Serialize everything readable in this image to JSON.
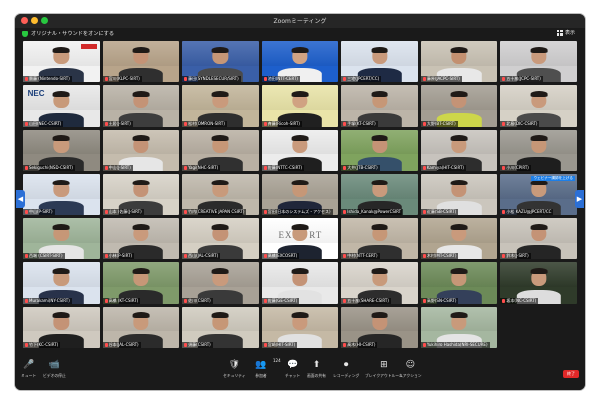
{
  "window": {
    "title": "Zoomミーティング"
  },
  "topbar": {
    "original_sound": "オリジナル・サウンドをオンにする",
    "view_label": "表示"
  },
  "tiles": [
    {
      "name": "齋藤 (Nintendo-SIRT)",
      "bg": "#f2f2f2",
      "shirt": "#2a3447",
      "skin": "#c89a7b",
      "special": "redtag"
    },
    {
      "name": "宮川(KLPC-SIRT)",
      "bg": "#b8a48a",
      "shirt": "#2f2f2f",
      "skin": "#c49376"
    },
    {
      "name": "藤田(SYNDLESECUR/SIRT)",
      "bg": "#3a5fa8",
      "shirt": "#4a4a4a",
      "skin": "#c69777"
    },
    {
      "name": "池田(NTT-CERT)",
      "bg": "#1d5fcc",
      "shirt": "#f0f0f0",
      "skin": "#d1a383"
    },
    {
      "name": "三宅(JPCERT/CC)",
      "bg": "#dbe3ee",
      "shirt": "#1e2a44",
      "skin": "#c99a7c"
    },
    {
      "name": "藤原(JACPC-SIRT)",
      "bg": "#c9c2b4",
      "shirt": "#e8e8e8",
      "skin": "#c39070"
    },
    {
      "name": "五十嵐(JCPC-SIRT)",
      "bg": "#d0cfd0",
      "shirt": "#4f4f4f",
      "skin": "#c99a7c"
    },
    {
      "name": "山田(NEC-CSIRT)",
      "bg": "#e8e8e8",
      "shirt": "#1f2a3d",
      "skin": "#c89a7a",
      "sign": "NEC"
    },
    {
      "name": "土居(J-SIRT)",
      "bg": "#b9b2a6",
      "shirt": "#3d3d3d",
      "skin": "#c49376"
    },
    {
      "name": "松村(OMRON-SIRT)",
      "bg": "#c2b59a",
      "shirt": "#2e2e2e",
      "skin": "#c99a7c"
    },
    {
      "name": "斉藤(Ricoh-SIRT)",
      "bg": "#e9e4a8",
      "shirt": "#202020",
      "skin": "#d0a282"
    },
    {
      "name": "手塚(KT-CSIRT)",
      "bg": "#bcb4a8",
      "shirt": "#3a3a3a",
      "skin": "#c69777"
    },
    {
      "name": "大野(BT-CSIRT)",
      "bg": "#a39d92",
      "shirt": "#cdd64a",
      "skin": "#c49376"
    },
    {
      "name": "北島(DIC-CSIRT)",
      "bg": "#d6d1c6",
      "shirt": "#4a4a4a",
      "skin": "#c99a7c"
    },
    {
      "name": "Sekiguchi(NSD-CSIRT)",
      "bg": "#8f8a80",
      "shirt": "#2a2a2a",
      "skin": "#c89a7b"
    },
    {
      "name": "中山(J-SIRT)",
      "bg": "#c5bcad",
      "shirt": "#e6e6e6",
      "skin": "#c49376"
    },
    {
      "name": "Yagi(NHC-SIRT)",
      "bg": "#b9b0a3",
      "shirt": "#303030",
      "skin": "#c69777"
    },
    {
      "name": "佐藤(NTTC-CSIRT)",
      "bg": "#ececec",
      "shirt": "#1f1f1f",
      "skin": "#c99a7c"
    },
    {
      "name": "大井(JTB-CSIRT)",
      "bg": "#7fa35e",
      "shirt": "#35506a",
      "skin": "#c49376"
    },
    {
      "name": "Kamiya(HIT-CSIRT)",
      "bg": "#c7c3bd",
      "shirt": "#2d2d2d",
      "skin": "#c89a7b"
    },
    {
      "name": "小川(CPIRT)",
      "bg": "#9a978f",
      "shirt": "#1e1e1e",
      "skin": "#c69777"
    },
    {
      "name": "中山(P-SIRT)",
      "bg": "#dbe3ee",
      "shirt": "#2c3a55",
      "skin": "#c99a7c"
    },
    {
      "name": "山本 (佐藤(J-SIRT)",
      "bg": "#d7d2c7",
      "shirt": "#3c3c3c",
      "skin": "#c49376"
    },
    {
      "name": "竹内(CREATIVE JAPAN CSIRT)",
      "bg": "#bfb8ab",
      "shirt": "#2b2b2b",
      "skin": "#c89a7b"
    },
    {
      "name": "宮田(日本のシステムズ・アクセス)",
      "bg": "#a9a295",
      "shirt": "#20263a",
      "skin": "#c69777"
    },
    {
      "name": "Ishida_Kanak@PowerCSIRT",
      "bg": "#6a8a7a",
      "shirt": "#272727",
      "skin": "#c99a7c"
    },
    {
      "name": "近藤(SB-CSIRT)",
      "bg": "#cbc6bd",
      "shirt": "#e0e0e0",
      "skin": "#c49376"
    },
    {
      "name": "小松 KAZU@JPCERT/CC",
      "bg": "#5a6d8a",
      "shirt": "#333333",
      "skin": "#c89a7b",
      "highlight": "ウェビナー講師を上げる"
    },
    {
      "name": "西端 (CSIRT-SIRT)",
      "bg": "#9fb59a",
      "shirt": "#e5e5e5",
      "skin": "#c69777"
    },
    {
      "name": "小林(P-SIRT)",
      "bg": "#c0bab0",
      "shirt": "#2a2a2a",
      "skin": "#c99a7c"
    },
    {
      "name": "西山(JAL-CSIRT)",
      "bg": "#d5cfc3",
      "shirt": "#3a3a3a",
      "skin": "#c49376"
    },
    {
      "name": "髙橋(EXCOSRT)",
      "bg": "#ffffff",
      "shirt": "#1d2330",
      "skin": "#c89a7b",
      "logo": "EXEC RT"
    },
    {
      "name": "中村(NTT-CERT)",
      "bg": "#c1b7a7",
      "shirt": "#2f2f2f",
      "skin": "#c69777"
    },
    {
      "name": "木村(MT-CSIRT)",
      "bg": "#b1a590",
      "shirt": "#e7e7e7",
      "skin": "#c99a7c"
    },
    {
      "name": "鈴木(J-SIRT)",
      "bg": "#c8c3ba",
      "shirt": "#252525",
      "skin": "#c49376"
    },
    {
      "name": "Murakami(NY-CSIRT)",
      "bg": "#dbe3ee",
      "shirt": "#28324a",
      "skin": "#c89a7b"
    },
    {
      "name": "高橋 (KT-CSIRT)",
      "bg": "#7f9a6a",
      "shirt": "#2a2a2a",
      "skin": "#c69777"
    },
    {
      "name": "佐川(CSIRT)",
      "bg": "#a8a196",
      "shirt": "#3a3a3a",
      "skin": "#c99a7c"
    },
    {
      "name": "佐藤(GE-CSIRT)",
      "bg": "#e9e9e9",
      "shirt": "#e2e2e2",
      "skin": "#c49376"
    },
    {
      "name": "五十嵐(SHARE-CSIRT)",
      "bg": "#d9d4cb",
      "shirt": "#2d2d2d",
      "skin": "#c89a7b"
    },
    {
      "name": "高野(SN-CSIRT)",
      "bg": "#6c8a58",
      "shirt": "#34405a",
      "skin": "#c69777"
    },
    {
      "name": "坂本(NC-CSIRT)",
      "bg": "#2f3b2a",
      "shirt": "#dddddd",
      "skin": "#c99a7c"
    },
    {
      "name": "竹下(KC-CSIRT)",
      "bg": "#cfc9bf",
      "shirt": "#1f1f1f",
      "skin": "#c49376"
    },
    {
      "name": "谷本(JAL-CSIRT)",
      "bg": "#bdb6aa",
      "shirt": "#2b2b2b",
      "skin": "#c89a7b"
    },
    {
      "name": "須藤(CSIRT)",
      "bg": "#d0cbbf",
      "shirt": "#333333",
      "skin": "#c69777"
    },
    {
      "name": "宮崎(HIT-SIRT)",
      "bg": "#c5b9a5",
      "shirt": "#e1e1e1",
      "skin": "#c99a7c"
    },
    {
      "name": "髙木(HI-CSIRT)",
      "bg": "#9a9387",
      "shirt": "#262626",
      "skin": "#c49376"
    },
    {
      "name": "Yukihiro Hashida(NRI-SECURE)",
      "bg": "#a5b7a0",
      "shirt": "#e4e4e4",
      "skin": "#c89a7b"
    }
  ],
  "toolbar": {
    "items": [
      {
        "label": "ミュート",
        "icon": "🎤",
        "icon_name": "microphone-icon"
      },
      {
        "label": "ビデオの停止",
        "icon": "📹",
        "icon_name": "video-camera-icon"
      },
      {
        "label": "セキュリティ",
        "icon": "🛡",
        "icon_name": "shield-icon"
      },
      {
        "label": "参加者",
        "icon": "👥",
        "icon_name": "participants-icon",
        "count": "124"
      },
      {
        "label": "チャット",
        "icon": "💬",
        "icon_name": "chat-icon"
      },
      {
        "label": "画面の共有",
        "icon": "⬆",
        "icon_name": "share-screen-icon"
      },
      {
        "label": "レコーディング",
        "icon": "⏺",
        "icon_name": "record-icon"
      },
      {
        "label": "ブレイクアウトルーム",
        "icon": "⊞",
        "icon_name": "breakout-rooms-icon"
      },
      {
        "label": "リアクション",
        "icon": "☺",
        "icon_name": "reactions-icon"
      }
    ],
    "end_label": "終了"
  },
  "colors": {
    "zoom_blue": "#2b6fd6",
    "end_red": "#e02828",
    "speaker_outline": "#d5ff37"
  }
}
